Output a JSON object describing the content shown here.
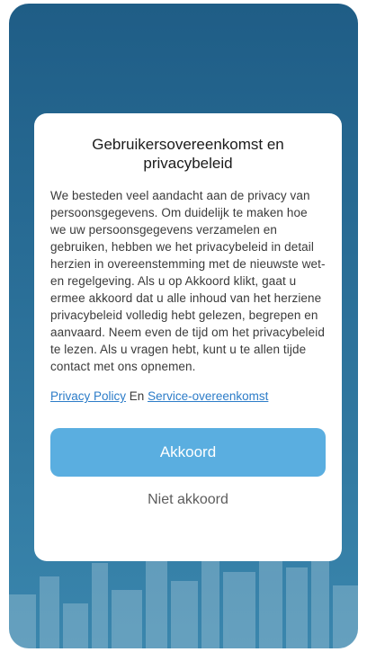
{
  "dialog": {
    "title": "Gebruikersovereenkomst en privacybeleid",
    "body": "We besteden veel aandacht aan de privacy van persoonsgegevens. Om duidelijk te maken hoe we uw persoonsgegevens verzamelen en gebruiken, hebben we het privacybeleid in detail herzien in overeenstemming met de nieuwste wet- en regelgeving. Als u op Akkoord klikt, gaat u ermee akkoord dat u alle inhoud van het herziene privacybeleid volledig hebt gelezen, begrepen en aanvaard. Neem even de tijd om het privacybeleid te lezen. Als u vragen hebt, kunt u te allen tijde contact met ons opnemen.",
    "links": {
      "privacy_policy": "Privacy Policy",
      "conjunction": "En",
      "service_agreement": "Service-overeenkomst"
    },
    "agree_label": "Akkoord",
    "disagree_label": "Niet akkoord"
  },
  "colors": {
    "background_top": "#1f5d86",
    "background_bottom": "#3a86ad",
    "primary_button": "#5aaee0",
    "link": "#2c7cc8"
  }
}
